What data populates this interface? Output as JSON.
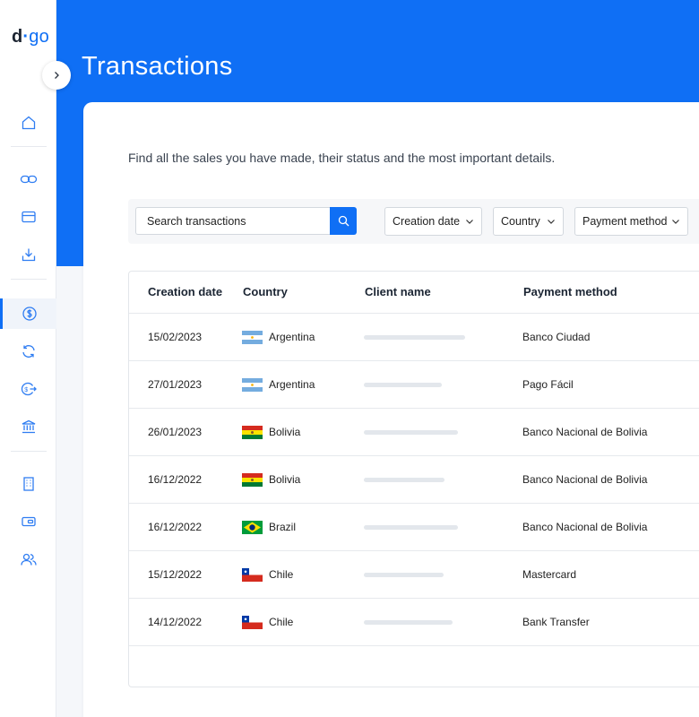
{
  "app": {
    "logo_d": "d",
    "logo_dot": "·",
    "logo_go": "go"
  },
  "page": {
    "title": "Transactions",
    "subtitle": "Find all the sales you have made, their status and the most important details."
  },
  "filters": {
    "search_placeholder": "Search transactions",
    "creation_date": "Creation date",
    "country": "Country",
    "payment_method": "Payment method"
  },
  "sidebar": {
    "items": [
      {
        "name": "home-icon",
        "active": false
      },
      {
        "name": "link-icon",
        "active": false
      },
      {
        "name": "credit-card-icon",
        "active": false
      },
      {
        "name": "download-icon",
        "active": false
      },
      {
        "name": "dollar-icon",
        "active": true
      },
      {
        "name": "refresh-icon",
        "active": false
      },
      {
        "name": "payout-icon",
        "active": false
      },
      {
        "name": "bank-icon",
        "active": false
      },
      {
        "name": "building-icon",
        "active": false
      },
      {
        "name": "wallet-icon",
        "active": false
      },
      {
        "name": "users-icon",
        "active": false
      }
    ]
  },
  "table": {
    "columns": [
      "Creation date",
      "Country",
      "Client name",
      "Payment method"
    ],
    "rows": [
      {
        "date": "15/02/2023",
        "country": "Argentina",
        "flag": "argentina",
        "client_name_bar": 0.75,
        "payment_method": "Banco Ciudad"
      },
      {
        "date": "27/01/2023",
        "country": "Argentina",
        "flag": "argentina",
        "client_name_bar": 0.58,
        "payment_method": "Pago Fácil"
      },
      {
        "date": "26/01/2023",
        "country": "Bolivia",
        "flag": "bolivia",
        "client_name_bar": 0.7,
        "payment_method": "Banco Nacional de Bolivia"
      },
      {
        "date": "16/12/2022",
        "country": "Bolivia",
        "flag": "bolivia",
        "client_name_bar": 0.6,
        "payment_method": "Banco Nacional de Bolivia"
      },
      {
        "date": "16/12/2022",
        "country": "Brazil",
        "flag": "brazil",
        "client_name_bar": 0.7,
        "payment_method": "Banco Nacional de Bolivia"
      },
      {
        "date": "15/12/2022",
        "country": "Chile",
        "flag": "chile",
        "client_name_bar": 0.59,
        "payment_method": "Mastercard"
      },
      {
        "date": "14/12/2022",
        "country": "Chile",
        "flag": "chile",
        "client_name_bar": 0.66,
        "payment_method": "Bank Transfer"
      }
    ]
  },
  "colors": {
    "brand": "#0f6ff5",
    "sidebar_icon": "#2f7df2",
    "text": "#1b2533"
  }
}
